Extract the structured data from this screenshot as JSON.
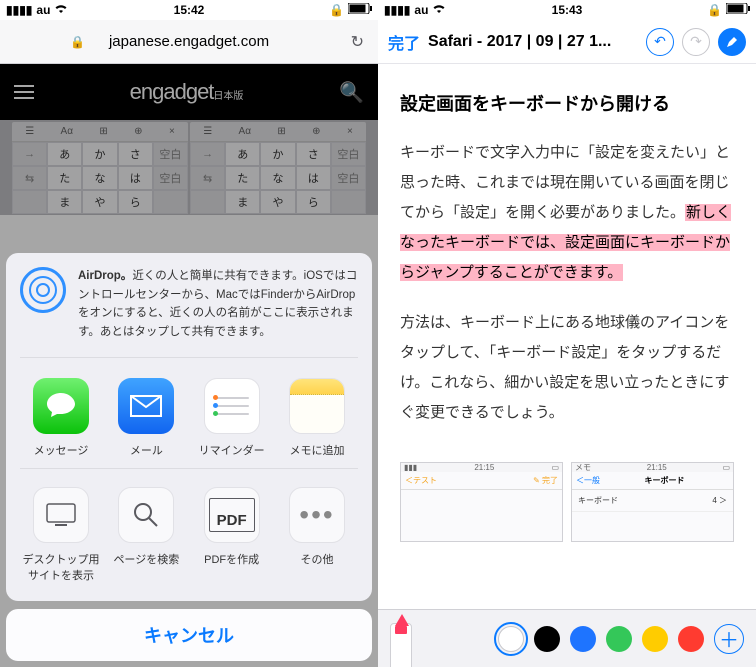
{
  "left": {
    "status": {
      "carrier": "au",
      "time": "15:42"
    },
    "url": "japanese.engadget.com",
    "brand": "engadget",
    "brand_sub": "日本版",
    "kbd": {
      "head": [
        "☰",
        "Aα",
        "⊞",
        "⊕",
        "×"
      ],
      "rows": [
        [
          "→",
          "あ",
          "か",
          "さ",
          "空白"
        ],
        [
          "⇆",
          "た",
          "な",
          "は",
          "空白"
        ],
        [
          "",
          "ま",
          "や",
          "ら",
          ""
        ]
      ]
    },
    "airdrop": {
      "lead": "AirDrop。",
      "body": "近くの人と簡単に共有できます。iOSではコントロールセンターから、MacではFinderからAirDropをオンにすると、近くの人の名前がここに表示されます。あとはタップして共有できます。"
    },
    "apps": [
      {
        "id": "messages",
        "label": "メッセージ"
      },
      {
        "id": "mail",
        "label": "メール"
      },
      {
        "id": "reminders",
        "label": "リマインダー"
      },
      {
        "id": "notes",
        "label": "メモに追加"
      }
    ],
    "actions": [
      {
        "id": "desktop",
        "label": "デスクトップ用\nサイトを表示"
      },
      {
        "id": "find",
        "label": "ページを検索"
      },
      {
        "id": "pdf",
        "label": "PDFを作成",
        "badge": "PDF"
      },
      {
        "id": "more",
        "label": "その他"
      }
    ],
    "cancel": "キャンセル"
  },
  "right": {
    "status": {
      "carrier": "au",
      "time": "15:43"
    },
    "done": "完了",
    "title": "Safari - 2017 | 09 | 27 1...",
    "heading": "設定画面をキーボードから開ける",
    "para1_a": "キーボードで文字入力中に「設定を変えたい」と思った時、これまでは現在開いている画面を閉じてから「設定」を開く必要がありました。",
    "para1_hl": "新しくなったキーボードでは、設定画面にキーボードからジャンプすることができます。",
    "para2": "方法は、キーボード上にある地球儀のアイコンをタップして、「キーボード設定」をタップするだけ。これなら、細かい設定を思い立ったときにすぐ変更できるでしょう。",
    "mini1": {
      "time": "21:15",
      "back": "＜テスト",
      "right": "✎ 完了"
    },
    "mini2": {
      "carrier": "メモ",
      "time": "21:15",
      "back": "＜一般",
      "title": "キーボード",
      "row": "キーボード",
      "val": "4 ＞"
    },
    "swatches": [
      "white",
      "black",
      "blue",
      "green",
      "yellow",
      "red"
    ]
  }
}
